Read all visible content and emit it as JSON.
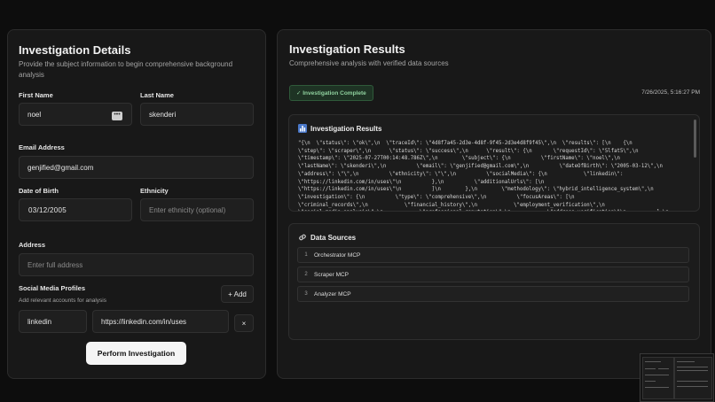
{
  "left": {
    "title": "Investigation Details",
    "subtitle": "Provide the subject information to begin comprehensive background analysis",
    "first_name": {
      "label": "First Name",
      "value": "noel"
    },
    "last_name": {
      "label": "Last Name",
      "value": "skenderi"
    },
    "email": {
      "label": "Email Address",
      "value": "genjified@gmail.com"
    },
    "dob": {
      "label": "Date of Birth",
      "value": "03/12/2005"
    },
    "ethnicity": {
      "label": "Ethnicity",
      "placeholder": "Enter ethnicity (optional)"
    },
    "address": {
      "label": "Address",
      "placeholder": "Enter full address"
    },
    "social": {
      "label": "Social Media Profiles",
      "sublabel": "Add relevant accounts for analysis",
      "add_label": "+ Add",
      "platform": "linkedin",
      "url": "https://linkedin.com/in/uses",
      "remove_label": "×"
    },
    "perform_label": "Perform Investigation"
  },
  "right": {
    "title": "Investigation Results",
    "subtitle": "Comprehensive analysis with verified data sources",
    "badge": "✓ Investigation Complete",
    "timestamp": "7/26/2025, 5:16:27 PM",
    "results_title": "Investigation Results",
    "json_text": "\"{\\n  \\\"status\\\": \\\"ok\\\",\\n  \\\"traceId\\\": \\\"4d8f7a45-2d3e-4d8f-9f45-2d3e4d8f9f45\\\",\\n  \\\"results\\\": [\\n    {\\n\n\\\"step\\\": \\\"scraper\\\",\\n      \\\"status\\\": \\\"success\\\",\\n      \\\"result\\\": {\\n       \\\"requestId\\\": \\\"5lfat5\\\",\\n\n\\\"timestamp\\\": \\\"2025-07-27T00:14:48.786Z\\\",\\n        \\\"subject\\\": {\\n          \\\"firstName\\\": \\\"noel\\\",\\n\n\\\"lastName\\\": \\\"skenderi\\\",\\n          \\\"email\\\": \\\"genjified@gmail.com\\\",\\n          \\\"dateOfBirth\\\": \\\"2005-03-12\\\",\\n\n\\\"address\\\": \\\"\\\",\\n          \\\"ethnicity\\\": \\\"\\\",\\n          \\\"socialMedia\\\": {\\n            \\\"linkedin\\\":\n\\\"https://linkedin.com/in/uses\\\"\\n          },\\n          \\\"additionalUrls\\\": [\\n\n\\\"https://linkedin.com/in/uses\\\"\\n          ]\\n        },\\n        \\\"methodology\\\": \\\"hybrid_intelligence_system\\\",\\n\n\\\"investigation\\\": {\\n          \\\"type\\\": \\\"comprehensive\\\",\\n          \\\"focusAreas\\\": [\\n\n\\\"criminal_records\\\",\\n            \\\"financial_history\\\",\\n            \\\"employment_verification\\\",\\n\n\\\"social_media_analysis\\\",\\n            \\\"professional_reputation\\\",\\n            \\\"address_verification\\\"\\n          ],\\n",
    "sources_title": "Data Sources",
    "sources": [
      {
        "num": "1",
        "name": "Orchestrator MCP"
      },
      {
        "num": "2",
        "name": "Scraper MCP"
      },
      {
        "num": "3",
        "name": "Analyzer MCP"
      }
    ]
  }
}
